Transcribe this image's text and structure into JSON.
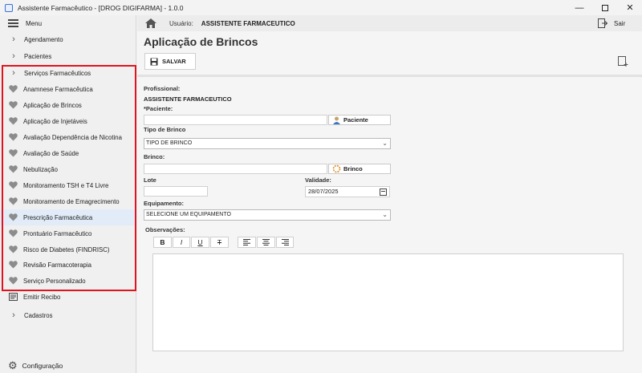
{
  "window": {
    "title": "Assistente Farmacêutico - [DROG DIGIFARMA] - 1.0.0"
  },
  "sidebar": {
    "menu_label": "Menu",
    "items": [
      {
        "label": "Agendamento",
        "icon": "chevron-right-icon"
      },
      {
        "label": "Pacientes",
        "icon": "chevron-right-icon"
      },
      {
        "label": "Serviços Farmacêuticos",
        "icon": "chevron-right-icon"
      },
      {
        "label": "Anamnese Farmacêutica",
        "icon": "heart-icon"
      },
      {
        "label": "Aplicação de Brincos",
        "icon": "heart-icon"
      },
      {
        "label": "Aplicação de Injetáveis",
        "icon": "heart-icon"
      },
      {
        "label": "Avaliação Dependência de Nicotina",
        "icon": "heart-icon"
      },
      {
        "label": "Avaliação de Saúde",
        "icon": "heart-icon"
      },
      {
        "label": "Nebulização",
        "icon": "heart-icon"
      },
      {
        "label": "Monitoramento TSH e T4 Livre",
        "icon": "heart-icon"
      },
      {
        "label": "Monitoramento de Emagrecimento",
        "icon": "heart-icon"
      },
      {
        "label": "Prescrição Farmacêutica",
        "icon": "heart-icon",
        "selected": true
      },
      {
        "label": "Prontuário Farmacêutico",
        "icon": "heart-icon"
      },
      {
        "label": "Risco de Diabetes (FINDRISC)",
        "icon": "heart-icon"
      },
      {
        "label": "Revisão Farmacoterapia",
        "icon": "heart-icon"
      },
      {
        "label": "Serviço Personalizado",
        "icon": "heart-icon"
      },
      {
        "label": "Emitir Recibo",
        "icon": "receipt-icon"
      },
      {
        "label": "Cadastros",
        "icon": "chevron-right-icon"
      }
    ],
    "config_label": "Configuração"
  },
  "topbar": {
    "user_label": "Usuário:",
    "user_name": "ASSISTENTE FARMACEUTICO",
    "exit_label": "Sair"
  },
  "page": {
    "title": "Aplicação de Brincos",
    "save_label": "SALVAR",
    "profissional_label": "Profissional:",
    "profissional_value": "ASSISTENTE FARMACEUTICO",
    "paciente_label": "*Paciente:",
    "paciente_value": "",
    "paciente_button": "Paciente",
    "tipo_label": "Tipo de Brinco",
    "tipo_value": "TIPO DE BRINCO",
    "brinco_label": "Brinco:",
    "brinco_value": "",
    "brinco_button": "Brinco",
    "lote_label": "Lote",
    "lote_value": "",
    "validade_label": "Validade:",
    "validade_value": "28/07/2025",
    "equipamento_label": "Equipamento:",
    "equipamento_value": "SELECIONE UM EQUIPAMENTO",
    "observacoes_label": "Observações:",
    "format_buttons": {
      "bold": "B",
      "italic": "I",
      "underline": "U",
      "strike": "T"
    }
  },
  "colors": {
    "highlight_border": "#e0141e",
    "selected_bg": "#e2ecf8",
    "heart": "#8c8c8c"
  }
}
